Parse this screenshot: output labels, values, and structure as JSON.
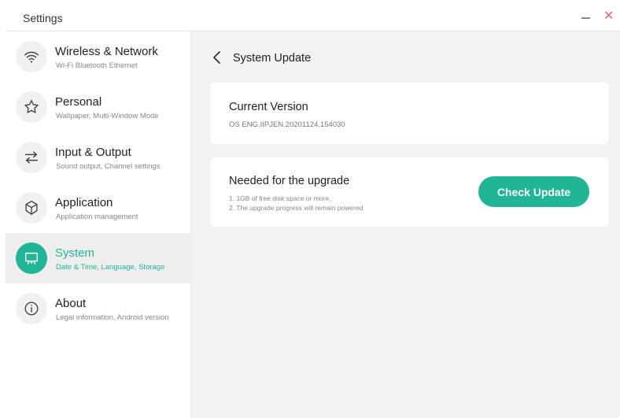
{
  "window": {
    "title": "Settings"
  },
  "colors": {
    "accent": "#1fb596",
    "close": "#e8665f"
  },
  "sidebar": {
    "items": [
      {
        "label": "Wireless & Network",
        "sub": "Wi-Fi Bluetooth Ethernet",
        "icon": "wifi-icon",
        "active": false
      },
      {
        "label": "Personal",
        "sub": "Wallpaper, Multi-Window Mode",
        "icon": "star-icon",
        "active": false
      },
      {
        "label": "Input & Output",
        "sub": "Sound output, Channel settings",
        "icon": "swap-arrows-icon",
        "active": false
      },
      {
        "label": "Application",
        "sub": "Application management",
        "icon": "cube-icon",
        "active": false
      },
      {
        "label": "System",
        "sub": "Date & Time, Language, Storage",
        "icon": "display-stand-icon",
        "active": true
      },
      {
        "label": "About",
        "sub": "Legal information, Android version",
        "icon": "info-icon",
        "active": false
      }
    ]
  },
  "main": {
    "title": "System Update",
    "current_version": {
      "title": "Current Version",
      "value": "OS ENG.IIPJEN.20201124.154030"
    },
    "upgrade": {
      "title": "Needed for the upgrade",
      "requirements": [
        "1. 1GB of free disk space or more.",
        "2. The upgrade progress will remain powered"
      ],
      "button_label": "Check Update"
    }
  }
}
